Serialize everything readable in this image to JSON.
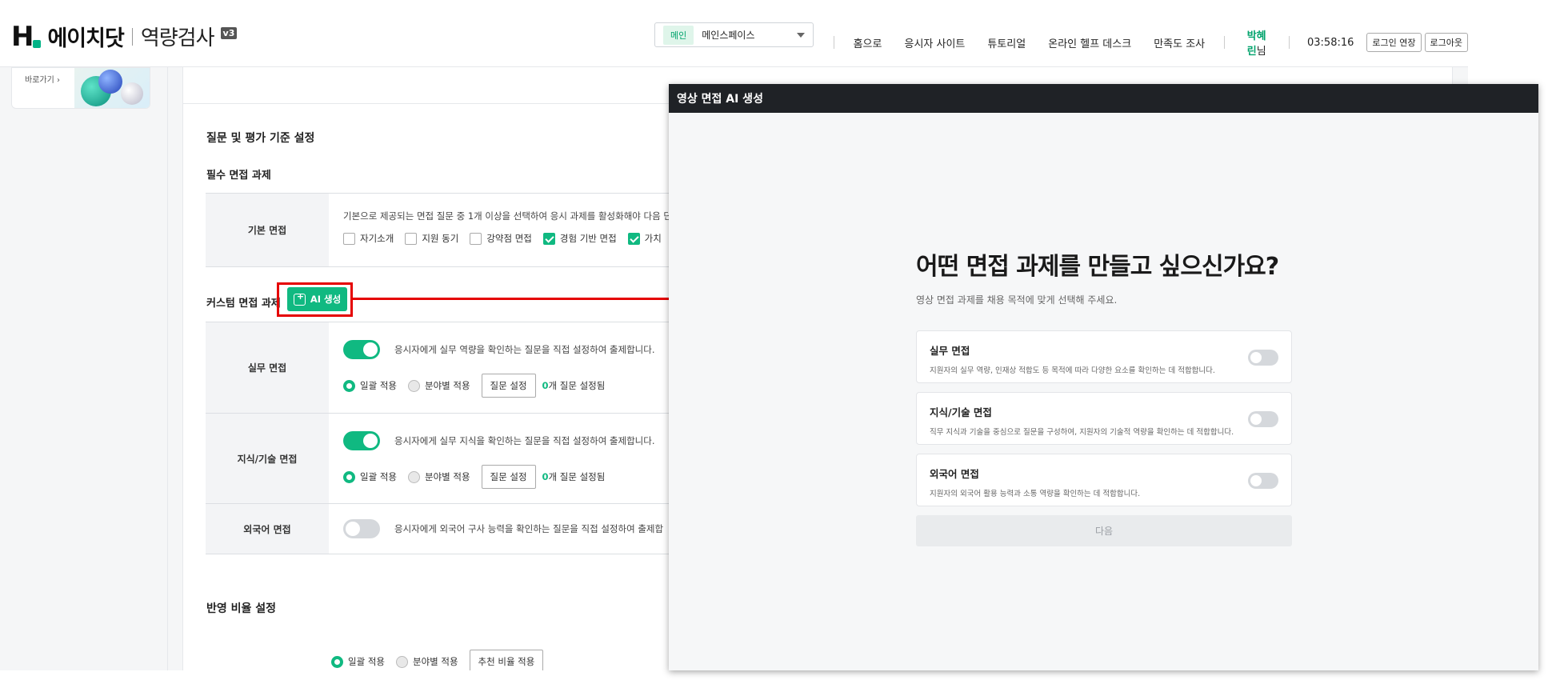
{
  "header": {
    "brand_name": "에이치닷",
    "brand_sub": "역량검사",
    "version": "v3",
    "workspace_tag": "메인",
    "workspace_name": "메인스페이스",
    "nav": [
      "홈으로",
      "응시자 사이트",
      "튜토리얼",
      "온라인 헬프 데스크",
      "만족도 조사"
    ],
    "user_name": "박혜린",
    "user_suffix": "님",
    "clock": "03:58:16",
    "extend_login": "로그인 연장",
    "logout": "로그아웃"
  },
  "sidebar": {
    "promo_link": "바로가기 ›"
  },
  "main": {
    "section_title": "질문 및 평가 기준 설정",
    "required_title": "필수 면접 과제",
    "basic": {
      "label": "기본 면접",
      "desc": "기본으로 제공되는 면접 질문 중 1개 이상을 선택하여 응시 과제를 활성화해야 다음 단",
      "options": [
        {
          "label": "자기소개",
          "checked": false
        },
        {
          "label": "지원 동기",
          "checked": false
        },
        {
          "label": "강약점 면접",
          "checked": false
        },
        {
          "label": "경험 기반 면접",
          "checked": true
        },
        {
          "label": "가치",
          "checked": true
        }
      ]
    },
    "custom_title": "커스텀 면접 과제",
    "ai_button": "AI 생성",
    "custom_rows": [
      {
        "label": "실무 면접",
        "enabled": true,
        "desc": "응시자에게 실무 역량을 확인하는 질문을 직접 설정하여 출제합니다.",
        "radio_all": "일괄 적용",
        "radio_field": "분야별 적용",
        "btn": "질문 설정",
        "count": "0",
        "count_suffix": "개 질문 설정됨"
      },
      {
        "label": "지식/기술 면접",
        "enabled": true,
        "desc": "응시자에게 실무 지식을 확인하는 질문을 직접 설정하여 출제합니다.",
        "radio_all": "일괄 적용",
        "radio_field": "분야별 적용",
        "btn": "질문 설정",
        "count": "0",
        "count_suffix": "개 질문 설정됨"
      },
      {
        "label": "외국어 면접",
        "enabled": false,
        "desc": "응시자에게 외국어 구사 능력을 확인하는 질문을 직접 설정하여 출제합"
      }
    ],
    "ratio_title": "반영 비율 설정",
    "ratio_radio_all": "일괄 적용",
    "ratio_radio_field": "분야별 적용",
    "ratio_btn": "추천 비율 적용"
  },
  "modal": {
    "header": "영상 면접 AI 생성",
    "title": "어떤 면접 과제를 만들고 싶으신가요?",
    "desc": "영상 면접 과제를 채용 목적에 맞게 선택해 주세요.",
    "options": [
      {
        "title": "실무 면접",
        "desc": "지원자의 실무 역량, 인재상 적합도 등 목적에 따라 다양한 요소를 확인하는 데 적합합니다.",
        "on": false
      },
      {
        "title": "지식/기술 면접",
        "desc": "직무 지식과 기술을 중심으로 질문을 구성하여, 지원자의 기술적 역량을 확인하는 데 적합합니다.",
        "on": false
      },
      {
        "title": "외국어 면접",
        "desc": "지원자의 외국어 활용 능력과 소통 역량을 확인하는 데 적합합니다.",
        "on": false
      }
    ],
    "next_button": "다음"
  },
  "colors": {
    "accent": "#10b981",
    "annotation": "#e50000",
    "modal_header": "#1f2226"
  }
}
